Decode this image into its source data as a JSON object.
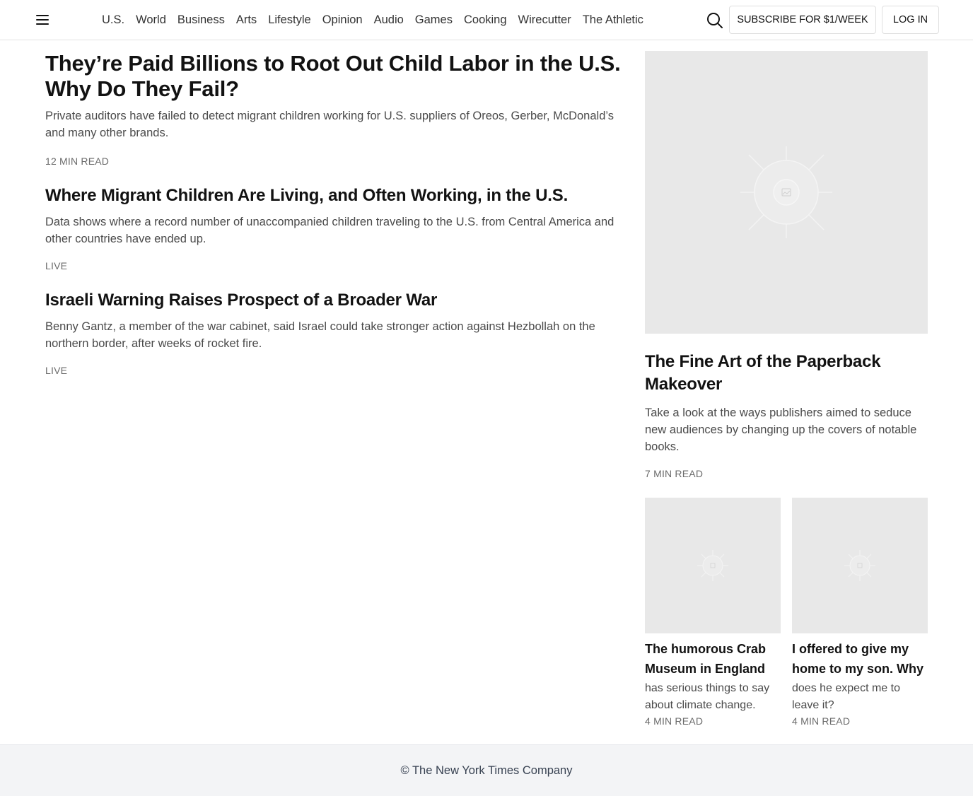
{
  "header": {
    "nav": [
      "U.S.",
      "World",
      "Business",
      "Arts",
      "Lifestyle",
      "Opinion",
      "Audio",
      "Games",
      "Cooking",
      "Wirecutter",
      "The Athletic"
    ],
    "subscribe_label": "SUBSCRIBE FOR $1/WEEK",
    "login_label": "LOG IN"
  },
  "main": {
    "stories": [
      {
        "headline": "They’re Paid Billions to Root Out Child Labor in the U.S. Why Do They Fail?",
        "summary": "Private auditors have failed to detect migrant children working for U.S. suppliers of Oreos, Gerber, McDonald’s and many other brands.",
        "meta": "12 MIN READ"
      },
      {
        "headline": "Where Migrant Children Are Living, and Often Working, in the U.S.",
        "summary": "Data shows where a record number of unaccompanied children traveling to the U.S. from Central America and other countries have ended up.",
        "meta": "LIVE"
      },
      {
        "headline": "Israeli Warning Raises Prospect of a Broader War",
        "summary": "Benny Gantz, a member of the war cabinet, said Israel could take stronger action against Hezbollah on the northern border, after weeks of rocket fire.",
        "meta": "LIVE"
      }
    ]
  },
  "side": {
    "feature": {
      "headline": "The Fine Art of the Paperback Makeover",
      "summary": "Take a look at the ways publishers aimed to seduce new audiences by changing up the covers of notable books.",
      "meta": "7 MIN READ"
    },
    "cards": [
      {
        "headline": "The humorous Crab Museum in England",
        "summary": "has serious things to say about climate change.",
        "meta": "4 MIN READ"
      },
      {
        "headline": "I offered to give my home to my son. Why",
        "summary": "does he expect me to leave it?",
        "meta": "4 MIN READ"
      }
    ]
  },
  "footer": {
    "copyright": "© The New York Times Company"
  }
}
